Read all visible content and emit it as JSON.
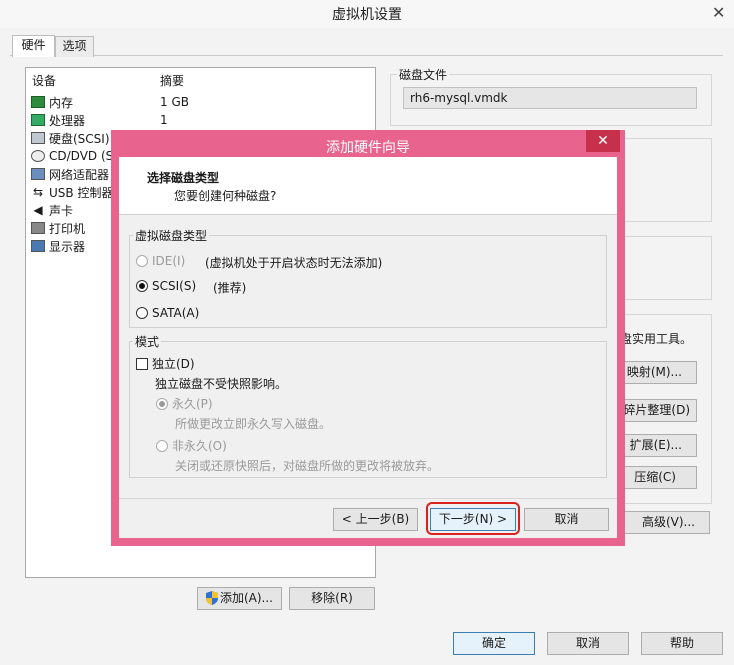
{
  "window": {
    "title": "虚拟机设置",
    "close_glyph": "✕"
  },
  "tabs": [
    {
      "label": "硬件"
    },
    {
      "label": "选项"
    }
  ],
  "device_list": {
    "col_device": "设备",
    "col_summary": "摘要",
    "rows": [
      {
        "name": "内存",
        "summary": "1 GB"
      },
      {
        "name": "处理器",
        "summary": "1"
      },
      {
        "name": "硬盘(SCSI)",
        "summary": ""
      },
      {
        "name": "CD/DVD (SA",
        "summary": ""
      },
      {
        "name": "网络适配器",
        "summary": ""
      },
      {
        "name": "USB 控制器",
        "summary": ""
      },
      {
        "name": "声卡",
        "summary": ""
      },
      {
        "name": "打印机",
        "summary": ""
      },
      {
        "name": "显示器",
        "summary": ""
      }
    ],
    "add_button": "添加(A)...",
    "remove_button": "移除(R)"
  },
  "right_panel": {
    "disk_file_label": "磁盘文件",
    "disk_file_value": "rh6-mysql.vmdk",
    "utilities_text": "盘实用工具。",
    "map_button": "映射(M)...",
    "defrag_button": "碎片整理(D)",
    "expand_button": "扩展(E)...",
    "compact_button": "压缩(C)",
    "advanced_button": "高级(V)..."
  },
  "footer": {
    "ok": "确定",
    "cancel": "取消",
    "help": "帮助"
  },
  "wizard": {
    "title": "添加硬件向导",
    "close_glyph": "✕",
    "heading": "选择磁盘类型",
    "subheading": "您要创建何种磁盘?",
    "disk_type_group": "虚拟磁盘类型",
    "ide": "IDE(I)",
    "ide_note": "(虚拟机处于开启状态时无法添加)",
    "scsi": "SCSI(S)",
    "scsi_note": "(推荐)",
    "sata": "SATA(A)",
    "mode_group": "模式",
    "independent": "独立(D)",
    "independent_desc": "独立磁盘不受快照影响。",
    "persistent": "永久(P)",
    "persistent_desc": "所做更改立即永久写入磁盘。",
    "nonpersistent": "非永久(O)",
    "nonpersistent_desc": "关闭或还原快照后，对磁盘所做的更改将被放弃。",
    "back_button": "< 上一步(B)",
    "next_button": "下一步(N) >",
    "cancel_button": "取消"
  },
  "colors": {
    "wizard_frame": "#e9638f",
    "wizard_close": "#c7304b",
    "annotation": "#d9221f"
  }
}
